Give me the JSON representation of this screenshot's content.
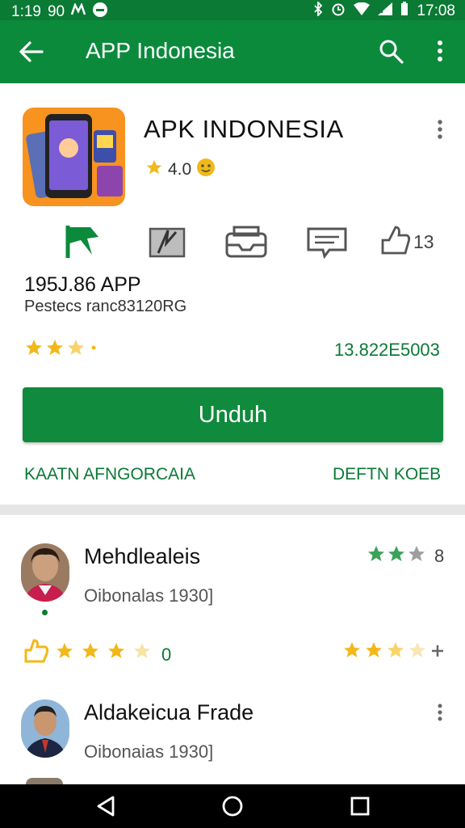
{
  "status_bar": {
    "time_left": "1:19",
    "signal_left": "90",
    "time_right": "17:08"
  },
  "app_bar": {
    "title": "APP Indonesia"
  },
  "app": {
    "name": "APK INDONESIA",
    "rating": "4.0",
    "likes": "13",
    "downloads": "195J.86 APP",
    "size_line": "Pestecs ranc83120RG",
    "star_rating": 3.5,
    "version": "13.822E5003"
  },
  "buttons": {
    "download": "Unduh",
    "link_left": "KAATN AFNGORCAIA",
    "link_right": "DEFTN KOEB"
  },
  "reviews": [
    {
      "name": "Mehdlealeis",
      "date": "Oibonalas 1930]",
      "stars": 2,
      "count": "8",
      "stars_row_left_value": "0",
      "stars_row_left": 3.5,
      "stars_row_right": 2.5
    },
    {
      "name": "Aldakeicua Frade",
      "date": "Oibonaias 1930]"
    }
  ],
  "colors": {
    "primary": "#0b8a3c",
    "status_bar": "#0a7a35",
    "star": "#f2b81a"
  }
}
